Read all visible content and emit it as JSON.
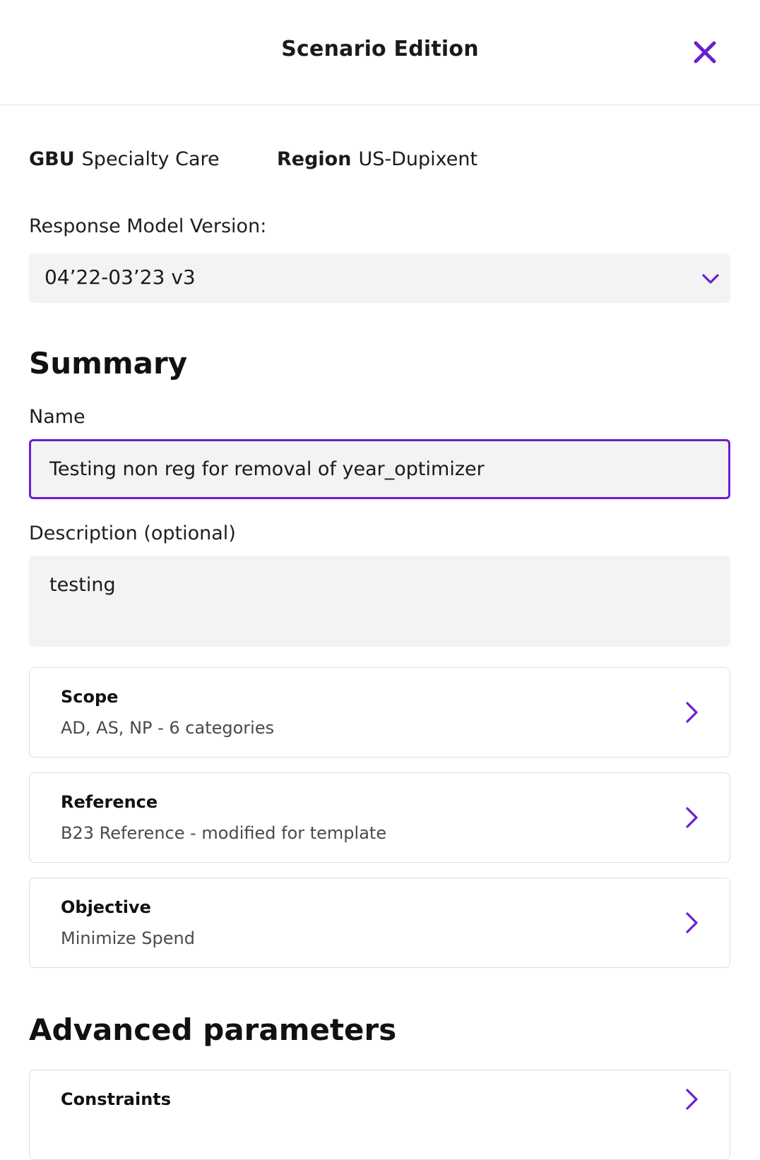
{
  "header": {
    "title": "Scenario Edition",
    "close_icon": "close-icon"
  },
  "meta": {
    "gbu_label": "GBU",
    "gbu_value": "Specialty Care",
    "region_label": "Region",
    "region_value": "US-Dupixent"
  },
  "response_model": {
    "label": "Response Model Version:",
    "selected": "04’22-03’23 v3",
    "icon": "chevron-down-icon"
  },
  "summary": {
    "title": "Summary",
    "name_label": "Name",
    "name_value": "Testing non reg for removal of year_optimizer",
    "description_label": "Description (optional)",
    "description_value": "testing",
    "cards": [
      {
        "title": "Scope",
        "subtitle": "AD, AS, NP - 6 categories",
        "icon": "chevron-right-icon"
      },
      {
        "title": "Reference",
        "subtitle": "B23 Reference - modified for template",
        "icon": "chevron-right-icon"
      },
      {
        "title": "Objective",
        "subtitle": "Minimize Spend",
        "icon": "chevron-right-icon"
      }
    ]
  },
  "advanced": {
    "title": "Advanced parameters",
    "cards": [
      {
        "title": "Constraints",
        "icon": "chevron-right-icon"
      }
    ]
  },
  "colors": {
    "accent": "#6b1fd1",
    "field_bg": "#f3f3f3",
    "border": "#dcdcdc"
  }
}
